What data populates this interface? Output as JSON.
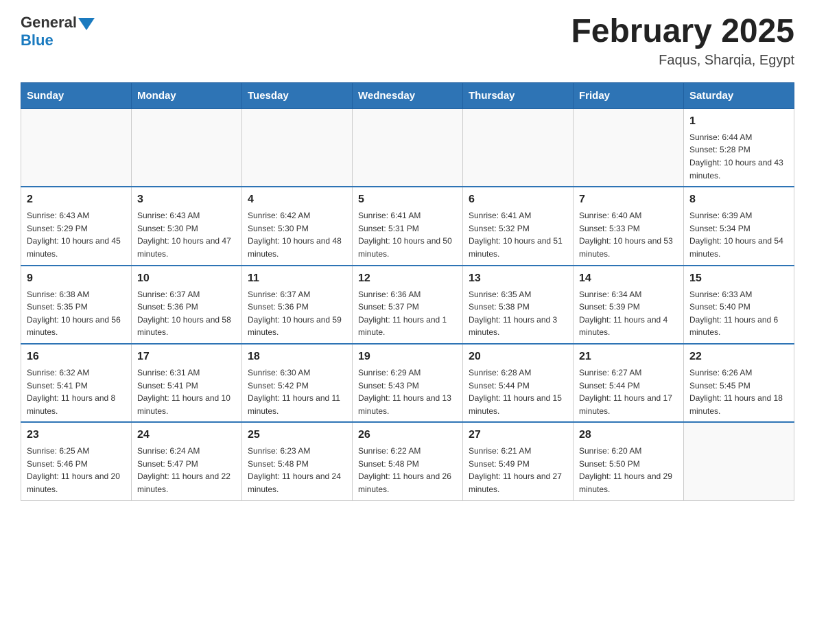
{
  "header": {
    "logo_general": "General",
    "logo_blue": "Blue",
    "title": "February 2025",
    "subtitle": "Faqus, Sharqia, Egypt"
  },
  "days_of_week": [
    "Sunday",
    "Monday",
    "Tuesday",
    "Wednesday",
    "Thursday",
    "Friday",
    "Saturday"
  ],
  "weeks": [
    [
      {
        "day": "",
        "sunrise": "",
        "sunset": "",
        "daylight": ""
      },
      {
        "day": "",
        "sunrise": "",
        "sunset": "",
        "daylight": ""
      },
      {
        "day": "",
        "sunrise": "",
        "sunset": "",
        "daylight": ""
      },
      {
        "day": "",
        "sunrise": "",
        "sunset": "",
        "daylight": ""
      },
      {
        "day": "",
        "sunrise": "",
        "sunset": "",
        "daylight": ""
      },
      {
        "day": "",
        "sunrise": "",
        "sunset": "",
        "daylight": ""
      },
      {
        "day": "1",
        "sunrise": "Sunrise: 6:44 AM",
        "sunset": "Sunset: 5:28 PM",
        "daylight": "Daylight: 10 hours and 43 minutes."
      }
    ],
    [
      {
        "day": "2",
        "sunrise": "Sunrise: 6:43 AM",
        "sunset": "Sunset: 5:29 PM",
        "daylight": "Daylight: 10 hours and 45 minutes."
      },
      {
        "day": "3",
        "sunrise": "Sunrise: 6:43 AM",
        "sunset": "Sunset: 5:30 PM",
        "daylight": "Daylight: 10 hours and 47 minutes."
      },
      {
        "day": "4",
        "sunrise": "Sunrise: 6:42 AM",
        "sunset": "Sunset: 5:30 PM",
        "daylight": "Daylight: 10 hours and 48 minutes."
      },
      {
        "day": "5",
        "sunrise": "Sunrise: 6:41 AM",
        "sunset": "Sunset: 5:31 PM",
        "daylight": "Daylight: 10 hours and 50 minutes."
      },
      {
        "day": "6",
        "sunrise": "Sunrise: 6:41 AM",
        "sunset": "Sunset: 5:32 PM",
        "daylight": "Daylight: 10 hours and 51 minutes."
      },
      {
        "day": "7",
        "sunrise": "Sunrise: 6:40 AM",
        "sunset": "Sunset: 5:33 PM",
        "daylight": "Daylight: 10 hours and 53 minutes."
      },
      {
        "day": "8",
        "sunrise": "Sunrise: 6:39 AM",
        "sunset": "Sunset: 5:34 PM",
        "daylight": "Daylight: 10 hours and 54 minutes."
      }
    ],
    [
      {
        "day": "9",
        "sunrise": "Sunrise: 6:38 AM",
        "sunset": "Sunset: 5:35 PM",
        "daylight": "Daylight: 10 hours and 56 minutes."
      },
      {
        "day": "10",
        "sunrise": "Sunrise: 6:37 AM",
        "sunset": "Sunset: 5:36 PM",
        "daylight": "Daylight: 10 hours and 58 minutes."
      },
      {
        "day": "11",
        "sunrise": "Sunrise: 6:37 AM",
        "sunset": "Sunset: 5:36 PM",
        "daylight": "Daylight: 10 hours and 59 minutes."
      },
      {
        "day": "12",
        "sunrise": "Sunrise: 6:36 AM",
        "sunset": "Sunset: 5:37 PM",
        "daylight": "Daylight: 11 hours and 1 minute."
      },
      {
        "day": "13",
        "sunrise": "Sunrise: 6:35 AM",
        "sunset": "Sunset: 5:38 PM",
        "daylight": "Daylight: 11 hours and 3 minutes."
      },
      {
        "day": "14",
        "sunrise": "Sunrise: 6:34 AM",
        "sunset": "Sunset: 5:39 PM",
        "daylight": "Daylight: 11 hours and 4 minutes."
      },
      {
        "day": "15",
        "sunrise": "Sunrise: 6:33 AM",
        "sunset": "Sunset: 5:40 PM",
        "daylight": "Daylight: 11 hours and 6 minutes."
      }
    ],
    [
      {
        "day": "16",
        "sunrise": "Sunrise: 6:32 AM",
        "sunset": "Sunset: 5:41 PM",
        "daylight": "Daylight: 11 hours and 8 minutes."
      },
      {
        "day": "17",
        "sunrise": "Sunrise: 6:31 AM",
        "sunset": "Sunset: 5:41 PM",
        "daylight": "Daylight: 11 hours and 10 minutes."
      },
      {
        "day": "18",
        "sunrise": "Sunrise: 6:30 AM",
        "sunset": "Sunset: 5:42 PM",
        "daylight": "Daylight: 11 hours and 11 minutes."
      },
      {
        "day": "19",
        "sunrise": "Sunrise: 6:29 AM",
        "sunset": "Sunset: 5:43 PM",
        "daylight": "Daylight: 11 hours and 13 minutes."
      },
      {
        "day": "20",
        "sunrise": "Sunrise: 6:28 AM",
        "sunset": "Sunset: 5:44 PM",
        "daylight": "Daylight: 11 hours and 15 minutes."
      },
      {
        "day": "21",
        "sunrise": "Sunrise: 6:27 AM",
        "sunset": "Sunset: 5:44 PM",
        "daylight": "Daylight: 11 hours and 17 minutes."
      },
      {
        "day": "22",
        "sunrise": "Sunrise: 6:26 AM",
        "sunset": "Sunset: 5:45 PM",
        "daylight": "Daylight: 11 hours and 18 minutes."
      }
    ],
    [
      {
        "day": "23",
        "sunrise": "Sunrise: 6:25 AM",
        "sunset": "Sunset: 5:46 PM",
        "daylight": "Daylight: 11 hours and 20 minutes."
      },
      {
        "day": "24",
        "sunrise": "Sunrise: 6:24 AM",
        "sunset": "Sunset: 5:47 PM",
        "daylight": "Daylight: 11 hours and 22 minutes."
      },
      {
        "day": "25",
        "sunrise": "Sunrise: 6:23 AM",
        "sunset": "Sunset: 5:48 PM",
        "daylight": "Daylight: 11 hours and 24 minutes."
      },
      {
        "day": "26",
        "sunrise": "Sunrise: 6:22 AM",
        "sunset": "Sunset: 5:48 PM",
        "daylight": "Daylight: 11 hours and 26 minutes."
      },
      {
        "day": "27",
        "sunrise": "Sunrise: 6:21 AM",
        "sunset": "Sunset: 5:49 PM",
        "daylight": "Daylight: 11 hours and 27 minutes."
      },
      {
        "day": "28",
        "sunrise": "Sunrise: 6:20 AM",
        "sunset": "Sunset: 5:50 PM",
        "daylight": "Daylight: 11 hours and 29 minutes."
      },
      {
        "day": "",
        "sunrise": "",
        "sunset": "",
        "daylight": ""
      }
    ]
  ]
}
